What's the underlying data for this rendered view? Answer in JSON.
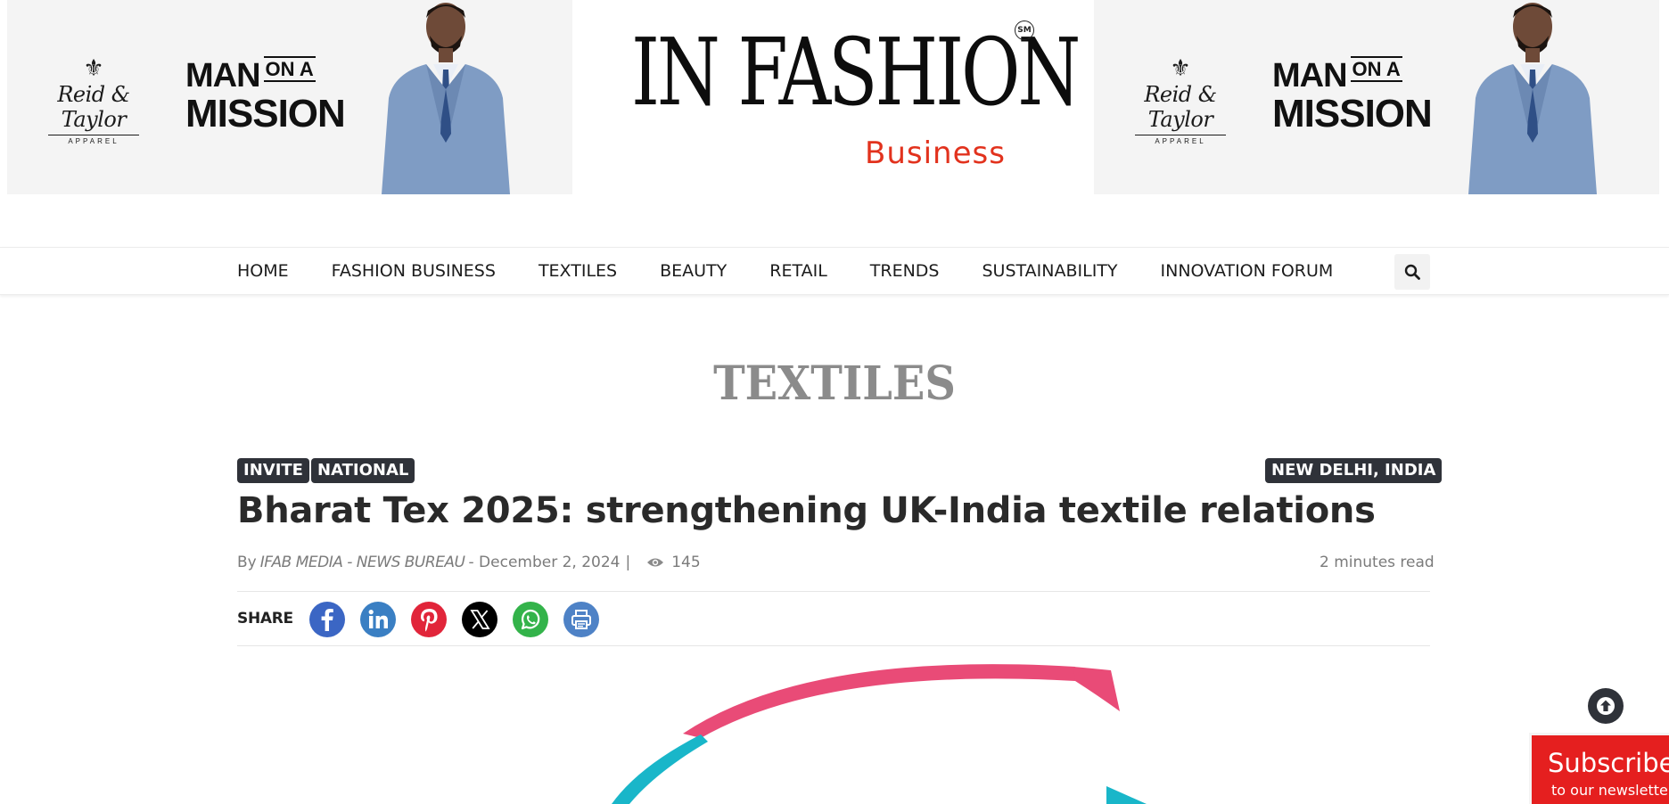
{
  "ads": {
    "brand_line1": "Reid & Taylor",
    "brand_line2": "APPAREL",
    "slogan_small": "ON A",
    "slogan_line1": "MAN",
    "slogan_line2": "MISSION"
  },
  "logo": {
    "main": "IN FASHION",
    "sub": "Business",
    "mark": "SM"
  },
  "nav": {
    "items": [
      "HOME",
      "FASHION BUSINESS",
      "TEXTILES",
      "BEAUTY",
      "RETAIL",
      "TRENDS",
      "SUSTAINABILITY",
      "INNOVATION FORUM"
    ],
    "search_icon": "search-icon"
  },
  "category": "TEXTILES",
  "article": {
    "tags": [
      "INVITE",
      "NATIONAL"
    ],
    "location": "NEW DELHI, INDIA",
    "title": "Bharat Tex 2025: strengthening UK-India textile relations",
    "by": "By",
    "author": "IFAB MEDIA - NEWS BUREAU",
    "date": "- December 2, 2024",
    "date_sep": "|",
    "views": "145",
    "read_time": "2 minutes read"
  },
  "share": {
    "label": "SHARE",
    "buttons": [
      {
        "name": "facebook-icon",
        "color": "#3b66c4"
      },
      {
        "name": "linkedin-icon",
        "color": "#3a7fc3"
      },
      {
        "name": "pinterest-icon",
        "color": "#e1253a"
      },
      {
        "name": "x-icon",
        "color": "#000000"
      },
      {
        "name": "whatsapp-icon",
        "color": "#33b34a"
      },
      {
        "name": "print-icon",
        "color": "#4e82c6"
      }
    ]
  },
  "subscribe": {
    "line1": "Subscribe",
    "line2": "to our newsletter"
  },
  "colors": {
    "accent_red": "#e2321d",
    "tag_bg": "#2f3239",
    "hero_pink": "#e94b77",
    "hero_teal": "#19b6c9"
  }
}
